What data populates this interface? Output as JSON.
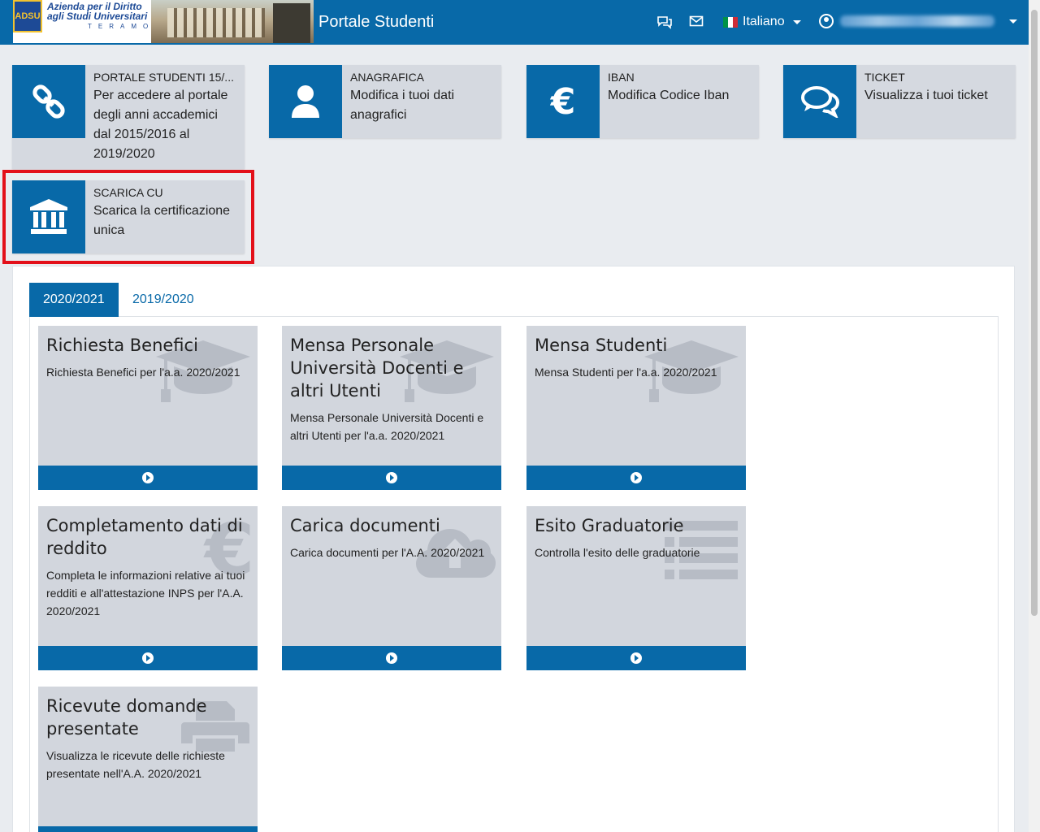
{
  "navbar": {
    "logo": {
      "badge_top": "AD",
      "badge_bottom": "SU",
      "name_line1": "Azienda per il Diritto",
      "name_line2": "agli Studi Universitari",
      "city": "TERAMO"
    },
    "brand": "Portale Studenti",
    "chat_icon": "comments-icon",
    "mail_icon": "envelope-icon",
    "language": "Italiano",
    "flag_colors": [
      "#009246",
      "#ffffff",
      "#ce2b37"
    ]
  },
  "tiles": [
    {
      "title": "PORTALE STUDENTI 15/...",
      "description_lines": [
        "Per accedere al portale",
        "degli anni accademici",
        "dal 2015/2016 al",
        "2019/2020"
      ],
      "icon": "link-icon"
    },
    {
      "title": "ANAGRAFICA",
      "description_lines": [
        "Modifica i tuoi dati",
        "anagrafici"
      ],
      "icon": "user-icon"
    },
    {
      "title": "IBAN",
      "description_lines": [
        "Modifica Codice Iban"
      ],
      "icon": "euro-icon"
    },
    {
      "title": "TICKET",
      "description_lines": [
        "Visualizza i tuoi ticket"
      ],
      "icon": "comments-icon"
    },
    {
      "title": "SCARICA CU",
      "description_lines": [
        "Scarica la certificazione",
        "unica"
      ],
      "icon": "bank-icon"
    }
  ],
  "tabs": {
    "active": "2020/2021",
    "other": "2019/2020"
  },
  "cards": [
    {
      "title": "Richiesta Benefici",
      "description": "Richiesta Benefici per l'a.a. 2020/2021",
      "icon": "graduation-cap-icon"
    },
    {
      "title": "Mensa Personale Università Docenti e altri Utenti",
      "description": "Mensa Personale Università Docenti e altri Utenti per l'a.a. 2020/2021",
      "icon": "graduation-cap-icon"
    },
    {
      "title": "Mensa Studenti",
      "description": "Mensa Studenti per l'a.a. 2020/2021",
      "icon": "graduation-cap-icon"
    },
    {
      "title": "Completamento dati di reddito",
      "description": "Completa le informazioni relative ai tuoi redditi e all'attestazione INPS per l'A.A. 2020/2021",
      "icon": "euro-icon"
    },
    {
      "title": "Carica documenti",
      "description": "Carica documenti per l'A.A. 2020/2021",
      "icon": "cloud-upload-icon"
    },
    {
      "title": "Esito Graduatorie",
      "description": "Controlla l'esito delle graduatorie",
      "icon": "list-icon"
    },
    {
      "title": "Ricevute domande presentate",
      "description": "Visualizza le ricevute delle richieste presentate nell'A.A. 2020/2021",
      "icon": "print-icon"
    }
  ],
  "colors": {
    "primary": "#0869a8",
    "tile_bg": "#d5d9e0",
    "highlight": "#e3101a"
  }
}
